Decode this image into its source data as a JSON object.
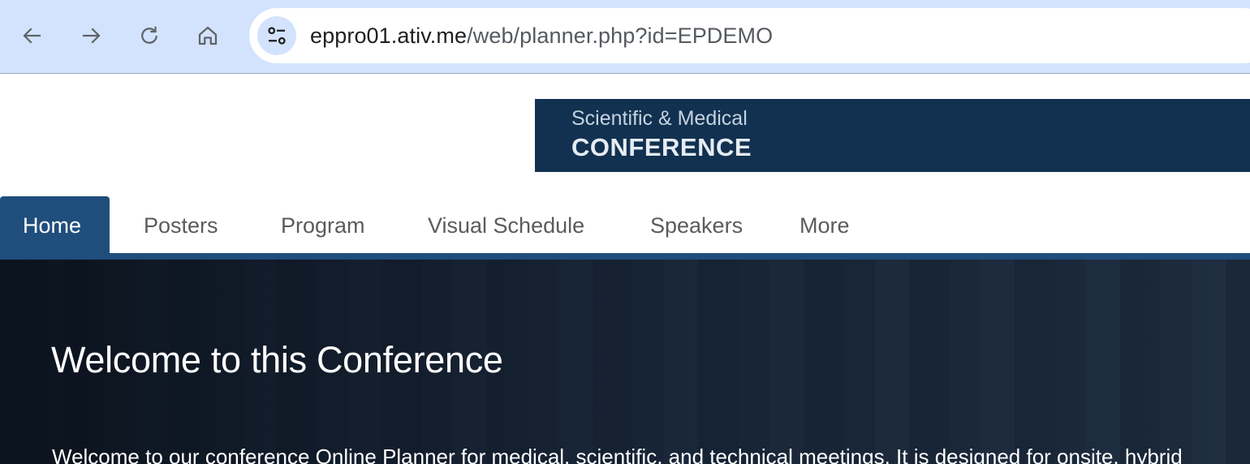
{
  "browser": {
    "url_host": "eppro01.ativ.me",
    "url_path": "/web/planner.php?id=EPDEMO",
    "icons": {
      "back": "arrow-left-icon",
      "forward": "arrow-right-icon",
      "reload": "reload-icon",
      "home": "home-icon",
      "site_info": "tune-icon"
    }
  },
  "header": {
    "banner_subtitle": "Scientific & Medical",
    "banner_title": "CONFERENCE"
  },
  "nav": {
    "tabs": [
      {
        "label": "Home",
        "active": true
      },
      {
        "label": "Posters",
        "active": false
      },
      {
        "label": "Program",
        "active": false
      },
      {
        "label": "Visual Schedule",
        "active": false
      },
      {
        "label": "Speakers",
        "active": false
      },
      {
        "label": "More",
        "active": false
      }
    ]
  },
  "hero": {
    "title": "Welcome to this Conference",
    "intro": "Welcome to our conference Online Planner for medical, scientific, and technical meetings. It is designed for onsite, hybrid"
  },
  "colors": {
    "chrome": "#d3e3fd",
    "brand_navy": "#123150",
    "nav_active": "#1f4d7c"
  }
}
